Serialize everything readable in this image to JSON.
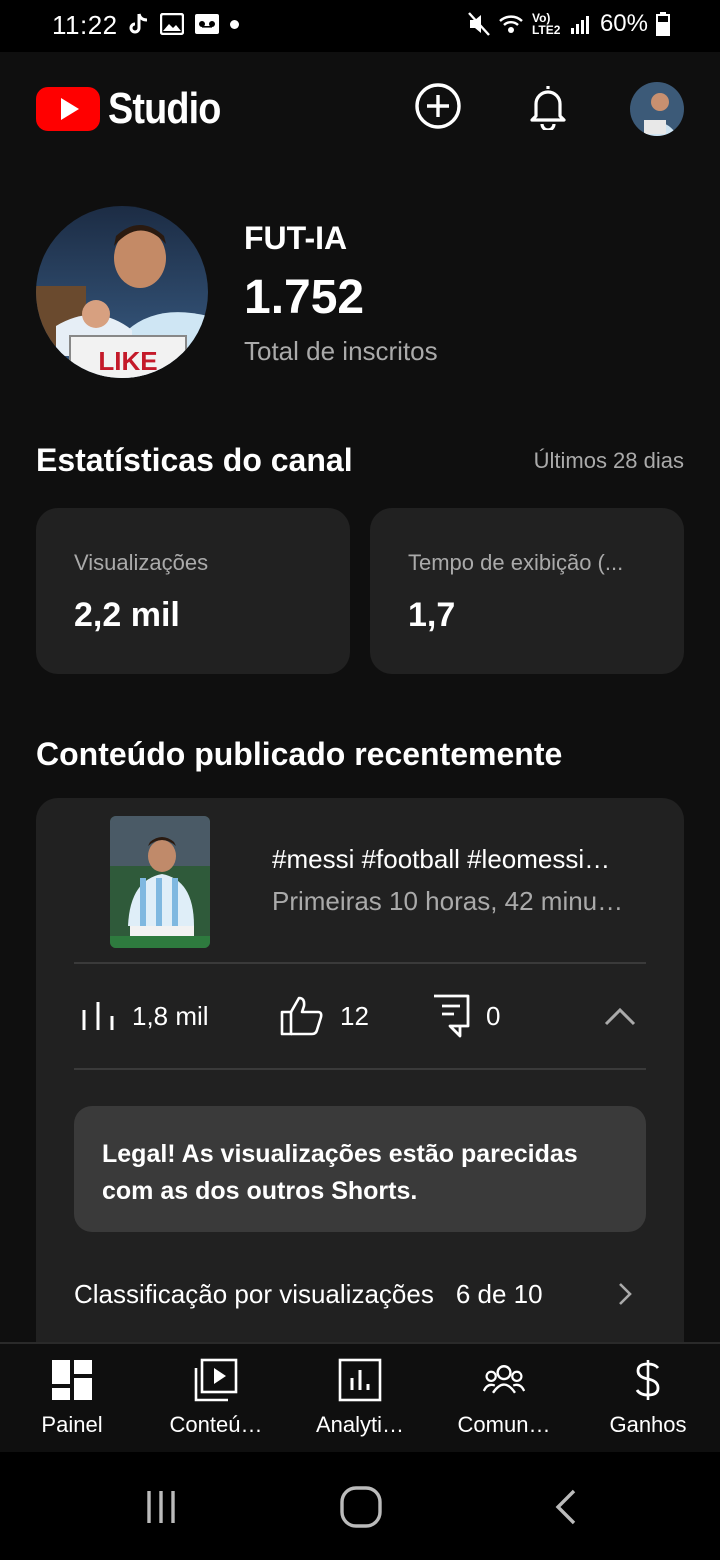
{
  "status_bar": {
    "time": "11:22",
    "battery": "60%",
    "network": "Vo) LTE2"
  },
  "header": {
    "logo_text": "Studio",
    "icons": [
      "create-icon",
      "notifications-icon",
      "account-avatar"
    ]
  },
  "channel": {
    "name": "FUT-IA",
    "subscribers": "1.752",
    "subscribers_label": "Total de inscritos",
    "avatar_text": "LIKE"
  },
  "stats": {
    "title": "Estatísticas do canal",
    "period": "Últimos 28 dias",
    "cards": [
      {
        "label": "Visualizações",
        "value": "2,2 mil"
      },
      {
        "label": "Tempo de exibição (...",
        "value": "1,7"
      }
    ]
  },
  "recent": {
    "title": "Conteúdo publicado recentemente",
    "video_title": "#messi #football #leomessi…",
    "video_subtitle": "Primeiras 10 horas, 42 minu…",
    "views": "1,8 mil",
    "likes": "12",
    "comments": "0",
    "insight": "Legal! As visualizações estão parecidas com as dos outros Shorts.",
    "rank_label": "Classificação por visualizações",
    "rank_value": "6 de 10"
  },
  "bottom_nav": [
    {
      "label": "Painel",
      "icon": "dashboard-icon"
    },
    {
      "label": "Conteú…",
      "icon": "content-icon"
    },
    {
      "label": "Analyti…",
      "icon": "analytics-icon"
    },
    {
      "label": "Comun…",
      "icon": "community-icon"
    },
    {
      "label": "Ganhos",
      "icon": "earnings-icon"
    }
  ],
  "colors": {
    "background": "#0f0f0f",
    "card": "#212121",
    "insight": "#3a3a3a",
    "brand_red": "#ff0000",
    "secondary_text": "#aaaaaa"
  }
}
